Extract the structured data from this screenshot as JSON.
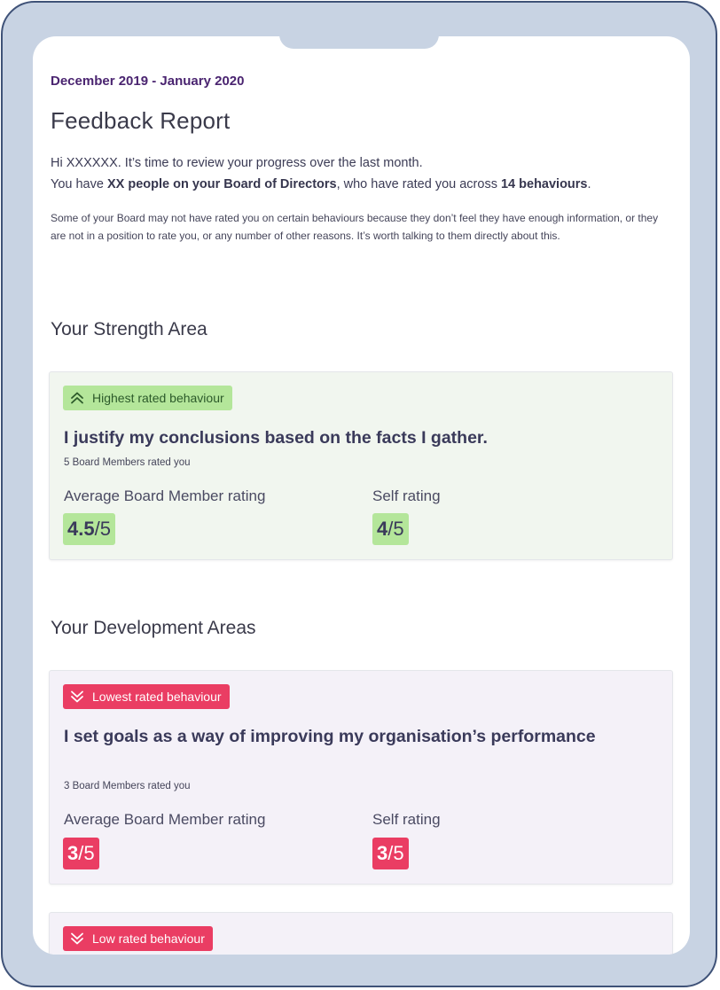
{
  "header": {
    "date_range": "December 2019 - January 2020",
    "title": "Feedback Report"
  },
  "intro": {
    "line1": "Hi XXXXXX. It’s time to review your progress over the last month.",
    "line2_prefix": "You have ",
    "line2_bold_people": "XX people on your Board of Directors",
    "line2_middle": ", who have rated you across ",
    "line2_bold_behaviours": "14 behaviours",
    "line2_suffix": ".",
    "note": "Some of your Board may not have rated you on certain behaviours because they don’t feel they have enough information, or they are not in a position to rate you, or any number of other reasons. It’s worth talking to them directly about this."
  },
  "strength": {
    "section_title": "Your Strength Area",
    "badge": "Highest rated behaviour",
    "badge_icon": "double-chevron-up-icon",
    "behaviour": "I justify my conclusions based on the facts I gather.",
    "raters": "5 Board Members rated you",
    "avg_label": "Average Board Member rating",
    "avg_score": "4.5",
    "avg_max": "/5",
    "self_label": "Self rating",
    "self_score": "4",
    "self_max": "/5",
    "accent": "#b4e69a"
  },
  "development": {
    "section_title": "Your Development Areas",
    "items": [
      {
        "badge": "Lowest rated behaviour",
        "badge_icon": "double-chevron-down-icon",
        "behaviour": "I set goals as a way of improving my organisation’s performance",
        "raters": "3 Board Members rated you",
        "avg_label": "Average Board Member rating",
        "avg_score": "3",
        "avg_max": "/5",
        "self_label": "Self rating",
        "self_score": "3",
        "self_max": "/5",
        "accent": "#ea3d63"
      },
      {
        "badge": "Low rated behaviour",
        "badge_icon": "double-chevron-down-icon"
      }
    ]
  }
}
